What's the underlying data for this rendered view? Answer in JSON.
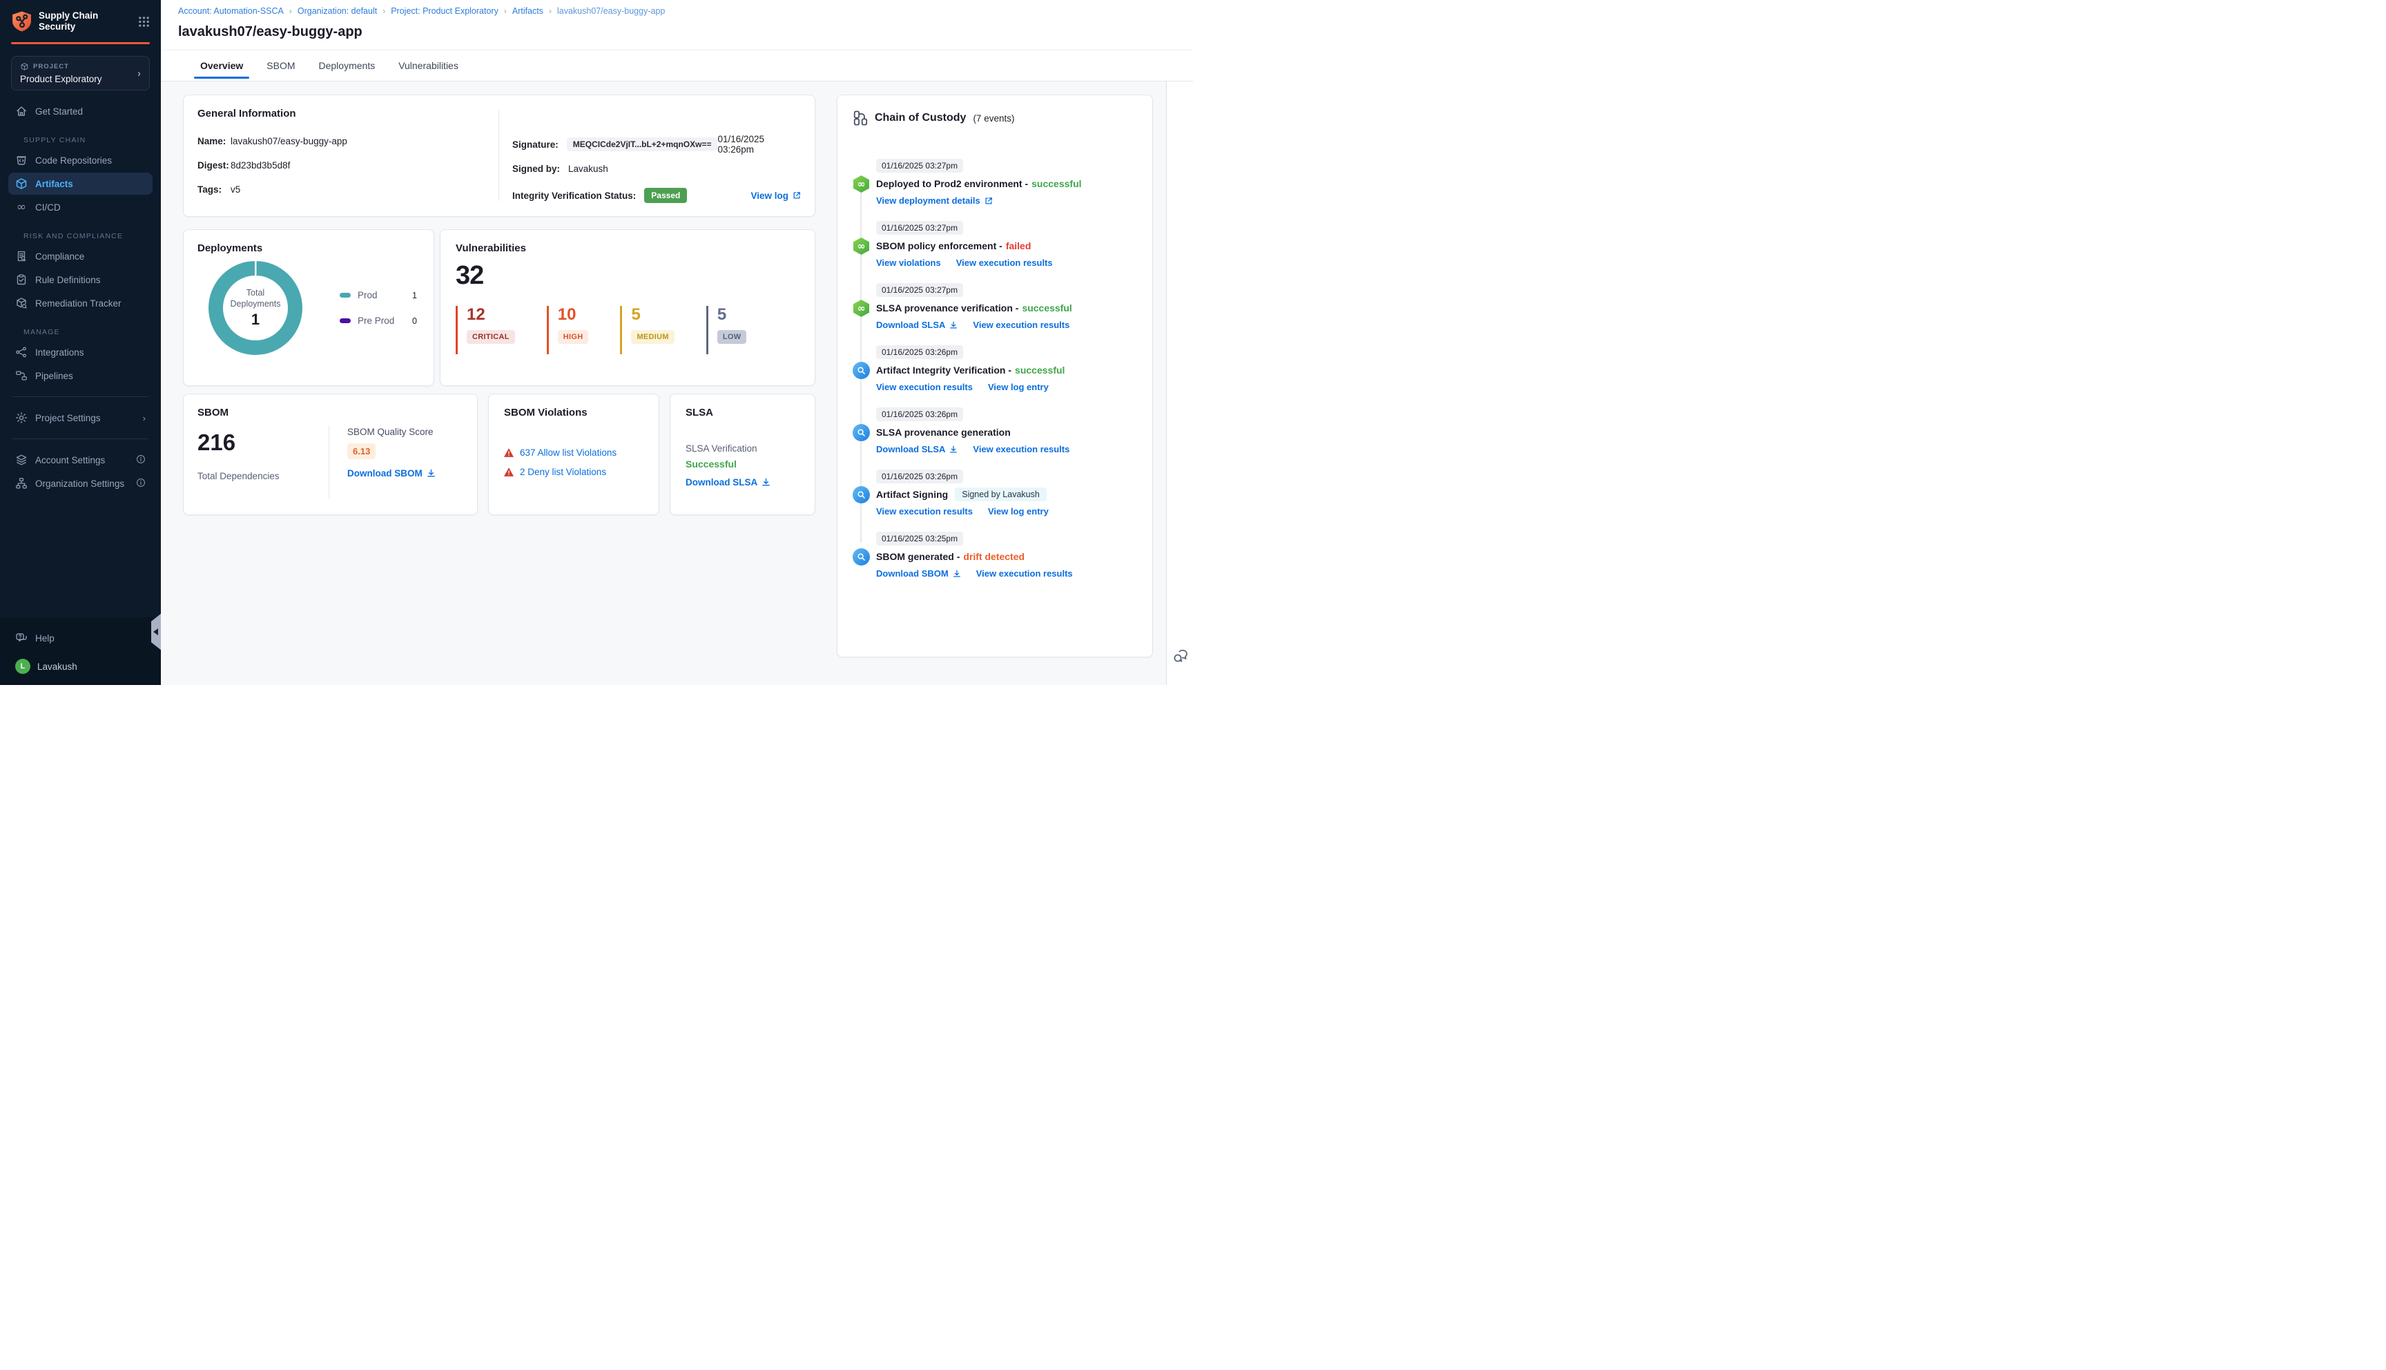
{
  "colors": {
    "accent_orange": "#f4563b",
    "link_blue": "#0a6ede",
    "success_green": "#3fa64b",
    "failed_red": "#e03c31",
    "drift_orange": "#ee5d2b",
    "prod_teal": "#4aa8b0",
    "preprod_purple": "#4c10a4",
    "sidebar_bg": "#0c1a2a"
  },
  "icons": {
    "brand": "shield-supply-chain-icon",
    "apps": "apps-grid-icon",
    "event_green": "pipeline-icon",
    "event_blue": "scan-icon",
    "warning": "warning-triangle-icon",
    "download": "download-icon",
    "external": "external-link-icon",
    "feedback": "chat-feedback-icon"
  },
  "sidebar": {
    "brand_line1": "Supply Chain",
    "brand_line2": "Security",
    "project_label": "PROJECT",
    "project_name": "Product Exploratory",
    "sections": {
      "supply_chain": "SUPPLY CHAIN",
      "risk": "RISK AND COMPLIANCE",
      "manage": "MANAGE"
    },
    "items": {
      "get_started": "Get Started",
      "code_repositories": "Code Repositories",
      "artifacts": "Artifacts",
      "cicd": "CI/CD",
      "compliance": "Compliance",
      "rule_definitions": "Rule Definitions",
      "remediation_tracker": "Remediation Tracker",
      "integrations": "Integrations",
      "pipelines": "Pipelines",
      "project_settings": "Project Settings",
      "account_settings": "Account Settings",
      "organization_settings": "Organization Settings",
      "help": "Help"
    },
    "user": {
      "name": "Lavakush",
      "initial": "L"
    }
  },
  "breadcrumb": {
    "separator": "›",
    "items": [
      "Account: Automation-SSCA",
      "Organization: default",
      "Project: Product Exploratory",
      "Artifacts",
      "lavakush07/easy-buggy-app"
    ]
  },
  "page_title": "lavakush07/easy-buggy-app",
  "tabs": [
    "Overview",
    "SBOM",
    "Deployments",
    "Vulnerabilities"
  ],
  "general_info": {
    "title": "General Information",
    "name_label": "Name:",
    "name": "lavakush07/easy-buggy-app",
    "digest_label": "Digest:",
    "digest": "8d23bd3b5d8f",
    "tags_label": "Tags:",
    "tags": "v5",
    "signature_label": "Signature:",
    "signature": "MEQCICde2VjIT...bL+2+mqnOXw==",
    "signature_time": "01/16/2025 03:26pm",
    "signed_by_label": "Signed by:",
    "signed_by": "Lavakush",
    "integrity_label": "Integrity Verification Status:",
    "integrity_status": "Passed",
    "view_log": "View log"
  },
  "deployments": {
    "title": "Deployments",
    "center_label": "Total Deployments",
    "total": "1",
    "legend": [
      {
        "label": "Prod",
        "value": "1"
      },
      {
        "label": "Pre Prod",
        "value": "0"
      }
    ],
    "chart_data": {
      "type": "pie",
      "title": "Total Deployments",
      "series": [
        {
          "name": "Prod",
          "value": 1
        },
        {
          "name": "Pre Prod",
          "value": 0
        }
      ],
      "total": 1
    }
  },
  "vulnerabilities": {
    "title": "Vulnerabilities",
    "total": "32",
    "severities": [
      {
        "label": "CRITICAL",
        "count": "12"
      },
      {
        "label": "HIGH",
        "count": "10"
      },
      {
        "label": "MEDIUM",
        "count": "5"
      },
      {
        "label": "LOW",
        "count": "5"
      }
    ]
  },
  "sbom": {
    "title": "SBOM",
    "total": "216",
    "total_label": "Total Dependencies",
    "quality_label": "SBOM Quality Score",
    "quality_score": "6.13",
    "download": "Download SBOM"
  },
  "sbom_violations": {
    "title": "SBOM Violations",
    "allow": "637 Allow list Violations",
    "deny": "2 Deny list Violations"
  },
  "slsa": {
    "title": "SLSA",
    "verification_label": "SLSA Verification",
    "verification_status": "Successful",
    "download": "Download SLSA"
  },
  "chain": {
    "title": "Chain of Custody",
    "count": "(7 events)",
    "events": [
      {
        "time": "01/16/2025 03:27pm",
        "title": "Deployed to Prod2 environment -",
        "status": "successful",
        "links": [
          {
            "label": "View deployment details"
          }
        ]
      },
      {
        "time": "01/16/2025 03:27pm",
        "title": "SBOM policy enforcement -",
        "status": "failed",
        "links": [
          {
            "label": "View violations"
          },
          {
            "label": "View execution results"
          }
        ]
      },
      {
        "time": "01/16/2025 03:27pm",
        "title": "SLSA provenance verification -",
        "status": "successful",
        "links": [
          {
            "label": "Download SLSA"
          },
          {
            "label": "View execution results"
          }
        ]
      },
      {
        "time": "01/16/2025 03:26pm",
        "title": "Artifact Integrity Verification -",
        "status": "successful",
        "links": [
          {
            "label": "View execution results"
          },
          {
            "label": "View log entry"
          }
        ]
      },
      {
        "time": "01/16/2025 03:26pm",
        "title": "SLSA provenance generation",
        "links": [
          {
            "label": "Download SLSA"
          },
          {
            "label": "View execution results"
          }
        ]
      },
      {
        "time": "01/16/2025 03:26pm",
        "title": "Artifact Signing",
        "badge": "Signed by Lavakush",
        "links": [
          {
            "label": "View execution results"
          },
          {
            "label": "View log entry"
          }
        ]
      },
      {
        "time": "01/16/2025 03:25pm",
        "title": "SBOM generated -",
        "status": "drift detected",
        "links": [
          {
            "label": "Download SBOM"
          },
          {
            "label": "View execution results"
          }
        ]
      }
    ]
  }
}
